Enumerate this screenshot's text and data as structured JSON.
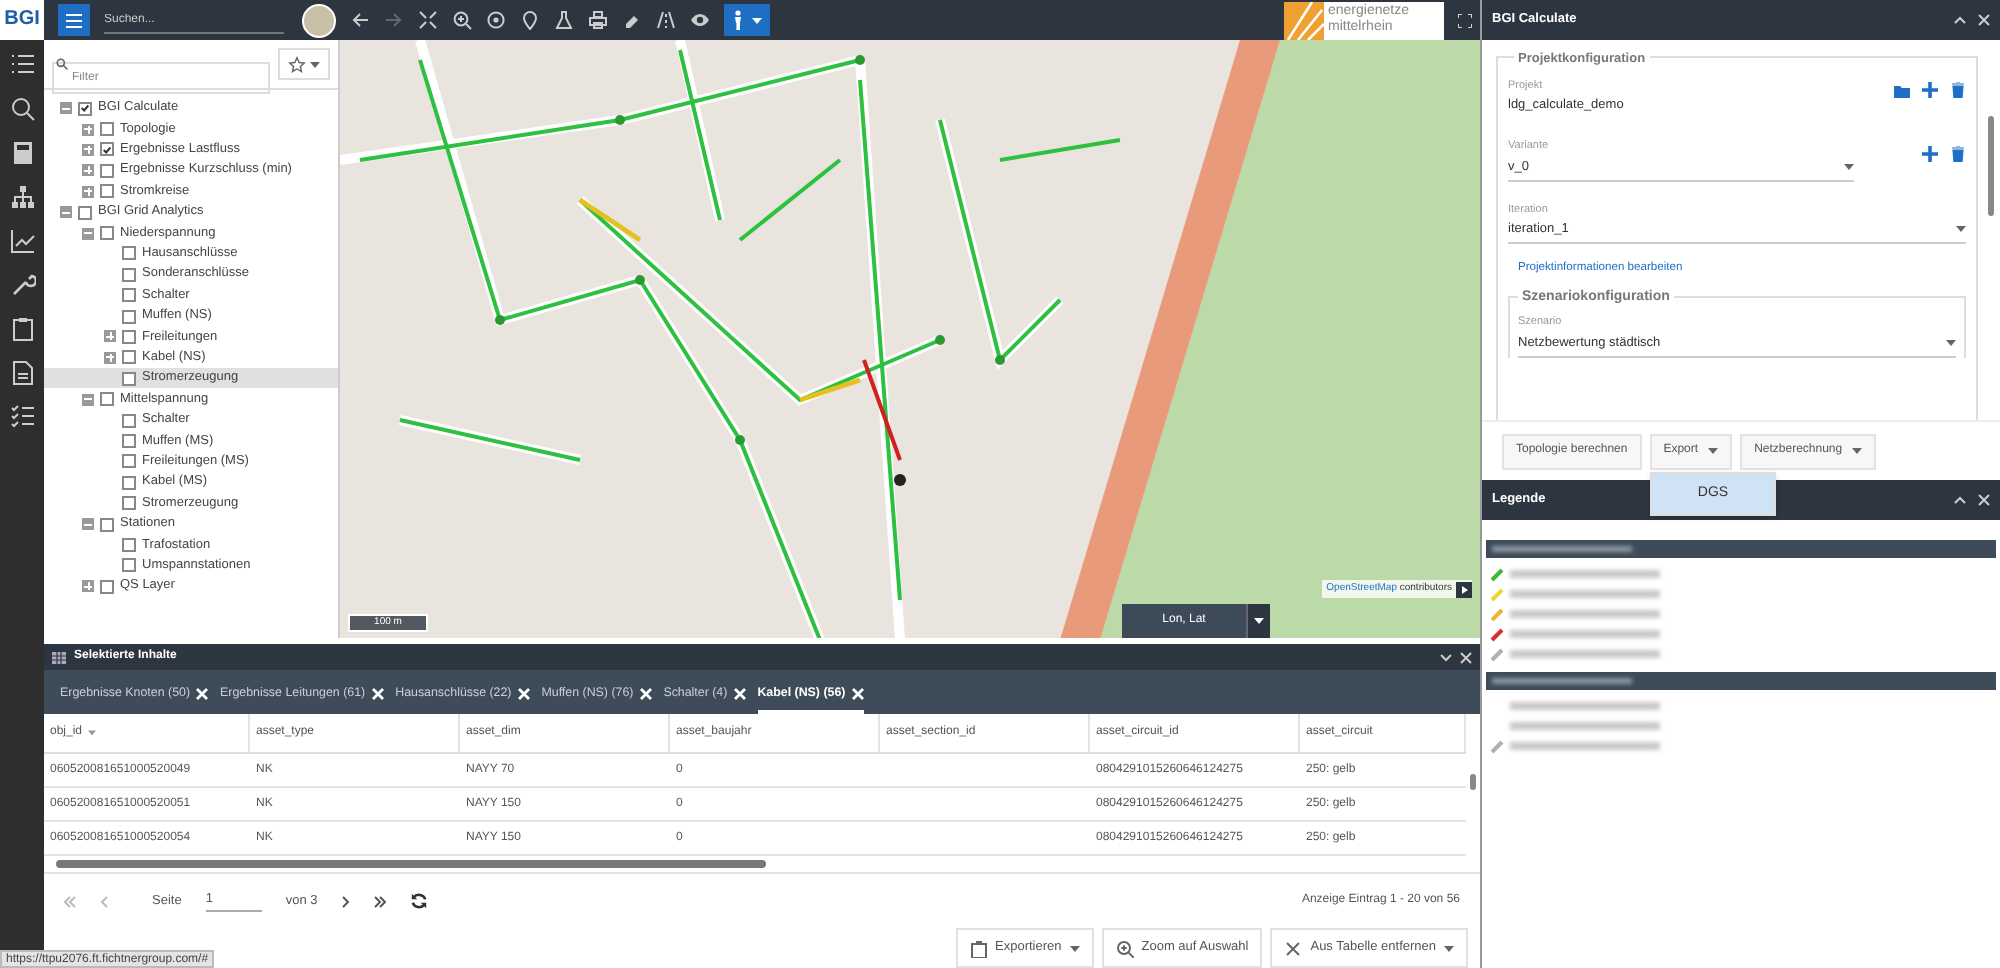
{
  "toolbar": {
    "logo": "BGI",
    "search_placeholder": "Suchen...",
    "forward_disabled": true,
    "brand_logo": [
      "energienetze",
      "mittelrhein"
    ]
  },
  "filter": {
    "placeholder": "Filter"
  },
  "tree": [
    {
      "label": "BGI Calculate",
      "checked": true,
      "expanded": true,
      "selected": false,
      "children": [
        {
          "label": "Topologie",
          "checked": false,
          "expanded": false,
          "selected": false
        },
        {
          "label": "Ergebnisse Lastfluss",
          "checked": true,
          "expanded": false,
          "selected": false
        },
        {
          "label": "Ergebnisse Kurzschluss (min)",
          "checked": false,
          "expanded": false,
          "selected": false
        },
        {
          "label": "Stromkreise",
          "checked": false,
          "expanded": false,
          "selected": false
        }
      ]
    },
    {
      "label": "BGI Grid Analytics",
      "checked": false,
      "expanded": true,
      "selected": false,
      "children": [
        {
          "label": "Niederspannung",
          "checked": false,
          "expanded": true,
          "selected": false,
          "children": [
            {
              "label": "Hausanschlüsse",
              "checked": false,
              "selected": false
            },
            {
              "label": "Sonderanschlüsse",
              "checked": false,
              "selected": false
            },
            {
              "label": "Schalter",
              "checked": false,
              "selected": false
            },
            {
              "label": "Muffen (NS)",
              "checked": false,
              "selected": false
            },
            {
              "label": "Freileitungen",
              "checked": false,
              "expanded": false,
              "selected": false
            },
            {
              "label": "Kabel (NS)",
              "checked": false,
              "expanded": false,
              "selected": false
            },
            {
              "label": "Stromerzeugung",
              "checked": false,
              "selected": true
            }
          ]
        },
        {
          "label": "Mittelspannung",
          "checked": false,
          "expanded": true,
          "selected": false,
          "children": [
            {
              "label": "Schalter",
              "checked": false,
              "selected": false
            },
            {
              "label": "Muffen (MS)",
              "checked": false,
              "selected": false
            },
            {
              "label": "Freileitungen (MS)",
              "checked": false,
              "selected": false
            },
            {
              "label": "Kabel (MS)",
              "checked": false,
              "selected": false
            },
            {
              "label": "Stromerzeugung",
              "checked": false,
              "selected": false
            }
          ]
        },
        {
          "label": "Stationen",
          "checked": false,
          "expanded": true,
          "selected": false,
          "children": [
            {
              "label": "Trafostation",
              "checked": false,
              "selected": false
            },
            {
              "label": "Umspannstationen",
              "checked": false,
              "selected": false
            }
          ]
        },
        {
          "label": "QS Layer",
          "checked": false,
          "expanded": false,
          "selected": false
        }
      ]
    }
  ],
  "map": {
    "scale": "100 m",
    "attribution": [
      "OpenStreetMap",
      "contributors"
    ],
    "coordinate_field": "Lon, Lat"
  },
  "calculate_panel": {
    "title": "BGI Calculate",
    "project_section": "Projektkonfiguration",
    "project": {
      "label": "Projekt",
      "value": "ldg_calculate_demo"
    },
    "variant": {
      "label": "Variante",
      "value": "v_0"
    },
    "iteration": {
      "label": "Iteration",
      "value": "iteration_1"
    },
    "edit_link": "Projektinformationen bearbeiten",
    "scenario_section": "Szenariokonfiguration",
    "scenario": {
      "label": "Szenario",
      "value": "Netzbewertung städtisch"
    },
    "buttons": [
      {
        "label": "Topologie berechnen",
        "dropdown": false
      },
      {
        "label": "Export",
        "dropdown": true
      },
      {
        "label": "Netzberechnung",
        "dropdown": true
      }
    ],
    "export_menu": [
      "DGS"
    ]
  },
  "legend": {
    "title": "Legende",
    "groups": [
      {
        "items": [
          {
            "kind": "line",
            "color": "#3cb93c"
          },
          {
            "kind": "line",
            "color": "#e8d830"
          },
          {
            "kind": "line",
            "color": "#eab530"
          },
          {
            "kind": "line",
            "color": "#d83030"
          },
          {
            "kind": "line",
            "color": "#b0b0b0"
          }
        ]
      },
      {
        "items": [
          {
            "kind": "plain"
          },
          {
            "kind": "plain"
          },
          {
            "kind": "line",
            "color": "#b0b0b0"
          }
        ]
      }
    ]
  },
  "selection": {
    "title": "Selektierte Inhalte",
    "tabs": [
      {
        "label": "Ergebnisse Knoten (50)",
        "selected": false
      },
      {
        "label": "Ergebnisse Leitungen (61)",
        "selected": false
      },
      {
        "label": "Hausanschlüsse (22)",
        "selected": false
      },
      {
        "label": "Muffen (NS) (76)",
        "selected": false
      },
      {
        "label": "Schalter (4)",
        "selected": false
      },
      {
        "label": "Kabel (NS) (56)",
        "selected": true
      }
    ],
    "columns": [
      "obj_id",
      "asset_type",
      "asset_dim",
      "asset_baujahr",
      "asset_section_id",
      "asset_circuit_id",
      "asset_circuit"
    ],
    "rows": [
      [
        "060520081651000520049",
        "NK",
        "NAYY 70",
        "0",
        "",
        "0804291015260646124275",
        "250: gelb"
      ],
      [
        "060520081651000520051",
        "NK",
        "NAYY 150",
        "0",
        "",
        "0804291015260646124275",
        "250: gelb"
      ],
      [
        "060520081651000520054",
        "NK",
        "NAYY 150",
        "0",
        "",
        "0804291015260646124275",
        "250: gelb"
      ]
    ],
    "pager": {
      "page_label": "Seite",
      "page": "1",
      "of": "von 3",
      "summary": "Anzeige Eintrag 1 - 20 von 56"
    },
    "actions": [
      {
        "label": "Exportieren",
        "dropdown": true
      },
      {
        "label": "Zoom auf Auswahl",
        "dropdown": false
      },
      {
        "label": "Aus Tabelle entfernen",
        "dropdown": true
      }
    ]
  },
  "status_url": "https://ttpu2076.ft.fichtnergroup.com/#"
}
